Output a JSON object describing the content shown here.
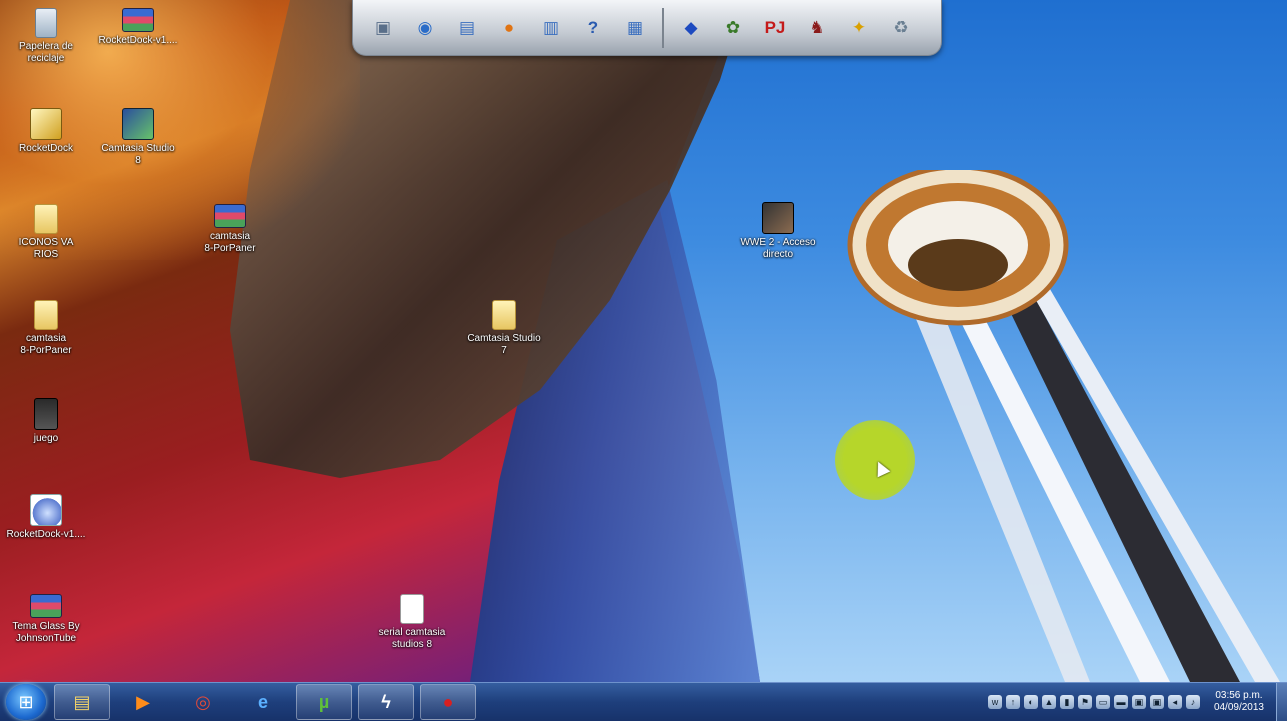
{
  "desktop_icons": [
    {
      "name": "recycle-bin",
      "label": "Papelera de\nreciclaje",
      "glyph": "recycle"
    },
    {
      "name": "rocketdock-rar-1",
      "label": "RocketDock-v1....",
      "glyph": "rar"
    },
    {
      "name": "rocketdock-shortcut",
      "label": "RocketDock",
      "glyph": "rocket"
    },
    {
      "name": "camtasia-studio-8-shortcut",
      "label": "Camtasia Studio\n8",
      "glyph": "cam"
    },
    {
      "name": "iconos-varios-folder",
      "label": "ICONOS VA\nRIOS",
      "glyph": "folder"
    },
    {
      "name": "camtasia-porpaner-rar",
      "label": "camtasia\n8-PorPaner",
      "glyph": "rar"
    },
    {
      "name": "camtasia-porpaner-folder",
      "label": "camtasia\n8-PorPaner",
      "glyph": "folder"
    },
    {
      "name": "camtasia-studio-7-folder",
      "label": "Camtasia Studio\n7",
      "glyph": "folder"
    },
    {
      "name": "wwe-shortcut",
      "label": "WWE 2 - Acceso\ndirecto",
      "glyph": "wwe"
    },
    {
      "name": "juego-shortcut",
      "label": "juego",
      "glyph": "game"
    },
    {
      "name": "rocketdock-setup",
      "label": "RocketDock-v1....",
      "glyph": "setup"
    },
    {
      "name": "tema-glass-rar",
      "label": "Tema Glass By\nJohnsonTube",
      "glyph": "rar"
    },
    {
      "name": "serial-camtasia-doc",
      "label": "serial camtasia\nstudios 8",
      "glyph": "doc"
    }
  ],
  "rocketdock": {
    "items": [
      {
        "name": "my-computer-icon",
        "glyph": "▣",
        "color": "#5a6f8a"
      },
      {
        "name": "internet-explorer-icon",
        "glyph": "◉",
        "color": "#2a6cc8"
      },
      {
        "name": "folder-icon",
        "glyph": "▤",
        "color": "#3b6fbf"
      },
      {
        "name": "baseball-glove-icon",
        "glyph": "●",
        "color": "#e07414"
      },
      {
        "name": "open-folder-icon",
        "glyph": "▥",
        "color": "#3b6fbf"
      },
      {
        "name": "help-icon",
        "glyph": "?",
        "color": "#2a5bb0"
      },
      {
        "name": "control-panel-icon",
        "glyph": "▦",
        "color": "#3b6fbf"
      },
      {
        "name": "sonic-icon",
        "glyph": "◆",
        "color": "#1d4ac0"
      },
      {
        "name": "game-character-icon",
        "glyph": "✿",
        "color": "#3a7a2a"
      },
      {
        "name": "project64-icon",
        "glyph": "PJ",
        "color": "#c41a1a"
      },
      {
        "name": "fighter-icon",
        "glyph": "♞",
        "color": "#8a1a1a"
      },
      {
        "name": "pokemon-icon",
        "glyph": "✦",
        "color": "#d9a000"
      },
      {
        "name": "recycle-bin-dock-icon",
        "glyph": "♻",
        "color": "#6a7f92"
      }
    ]
  },
  "taskbar": {
    "start_glyph": "⊞",
    "buttons": [
      {
        "name": "windows-explorer-button",
        "glyph": "▤",
        "color": "#f2d36a",
        "pinned": true
      },
      {
        "name": "media-player-button",
        "glyph": "▶",
        "color": "#ff8c1a",
        "pinned": false
      },
      {
        "name": "chrome-button",
        "glyph": "◎",
        "color": "#e04a3a",
        "pinned": false
      },
      {
        "name": "internet-explorer-button",
        "glyph": "e",
        "color": "#5bb0ff",
        "pinned": false
      },
      {
        "name": "utorrent-button",
        "glyph": "µ",
        "color": "#5fc03a",
        "pinned": true
      },
      {
        "name": "rocket-app-button",
        "glyph": "ϟ",
        "color": "#ffffff",
        "pinned": true
      },
      {
        "name": "camtasia-recorder-button",
        "glyph": "●",
        "color": "#d92020",
        "pinned": true
      }
    ],
    "tray": [
      "w",
      "↑",
      "◐",
      "▲",
      "▮",
      "⚑",
      "▭",
      "▬",
      "▣",
      "▣",
      "◂",
      "♪"
    ],
    "clock_time": "03:56 p.m.",
    "clock_date": "04/09/2013"
  }
}
